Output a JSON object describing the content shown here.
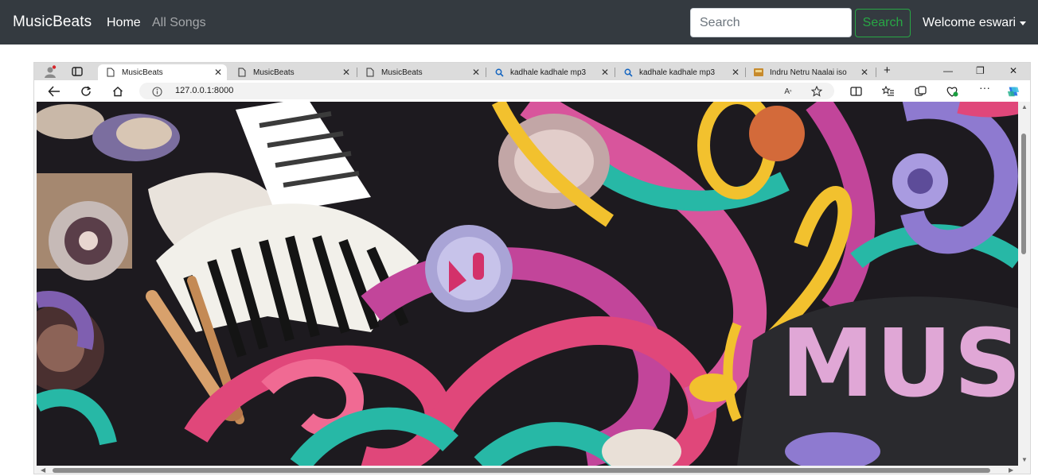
{
  "navbar": {
    "brand": "MusicBeats",
    "links": [
      "Home",
      "All Songs"
    ],
    "search_placeholder": "Search",
    "search_button": "Search",
    "user_menu": "Welcome eswari"
  },
  "embedded_browser": {
    "tabs": [
      {
        "title": "MusicBeats",
        "favicon": "page-icon",
        "active": true
      },
      {
        "title": "MusicBeats",
        "favicon": "page-icon",
        "active": false
      },
      {
        "title": "MusicBeats",
        "favicon": "page-icon",
        "active": false
      },
      {
        "title": "kadhale kadhale mp3",
        "favicon": "search-icon",
        "active": false
      },
      {
        "title": "kadhale kadhale mp3",
        "favicon": "search-icon",
        "active": false
      },
      {
        "title": "Indru Netru Naalai iso",
        "favicon": "site-icon",
        "active": false
      }
    ],
    "address": "127.0.0.1:8000",
    "page_artwork_text": "MUS",
    "colors": {
      "pink": "#e0477a",
      "magenta": "#c2459a",
      "teal": "#27b8a6",
      "yellow": "#f2c12e",
      "purple": "#8e7ad0",
      "dark": "#1d1a1f"
    }
  }
}
